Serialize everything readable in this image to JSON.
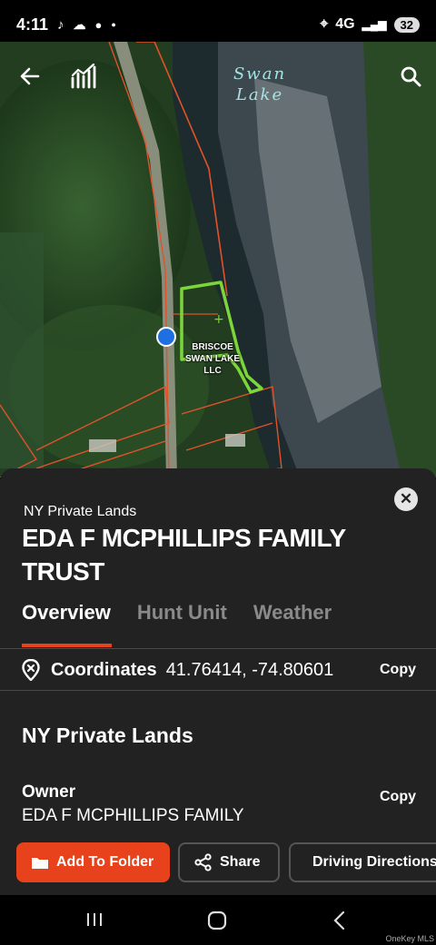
{
  "status_bar": {
    "time": "4:11",
    "network": "4G",
    "battery": "32"
  },
  "map": {
    "lake_label": "Swan Lake",
    "parcel_label": "BRISCOE SWAN LAKE LLC",
    "back_icon": "arrow-left-icon",
    "chart_icon": "chart-icon",
    "search_icon": "search-icon",
    "parcel_outline_color": "#7cd63a",
    "boundary_color": "#e0532a",
    "location_dot_color": "#1e6fe0"
  },
  "sheet": {
    "category": "NY Private Lands",
    "title": "EDA F MCPHILLIPS FAMILY TRUST",
    "tabs": [
      {
        "label": "Overview",
        "active": true
      },
      {
        "label": "Hunt Unit",
        "active": false
      },
      {
        "label": "Weather",
        "active": false
      }
    ],
    "coordinates": {
      "label": "Coordinates",
      "value": "41.76414, -74.80601",
      "copy_label": "Copy"
    },
    "section_title": "NY Private Lands",
    "owner": {
      "label": "Owner",
      "value": "EDA F MCPHILLIPS FAMILY",
      "copy_label": "Copy"
    },
    "actions": {
      "add_to_folder": "Add To Folder",
      "share": "Share",
      "driving_directions": "Driving Directions"
    },
    "accent_color": "#e8421c"
  },
  "watermark": "OneKey MLS"
}
